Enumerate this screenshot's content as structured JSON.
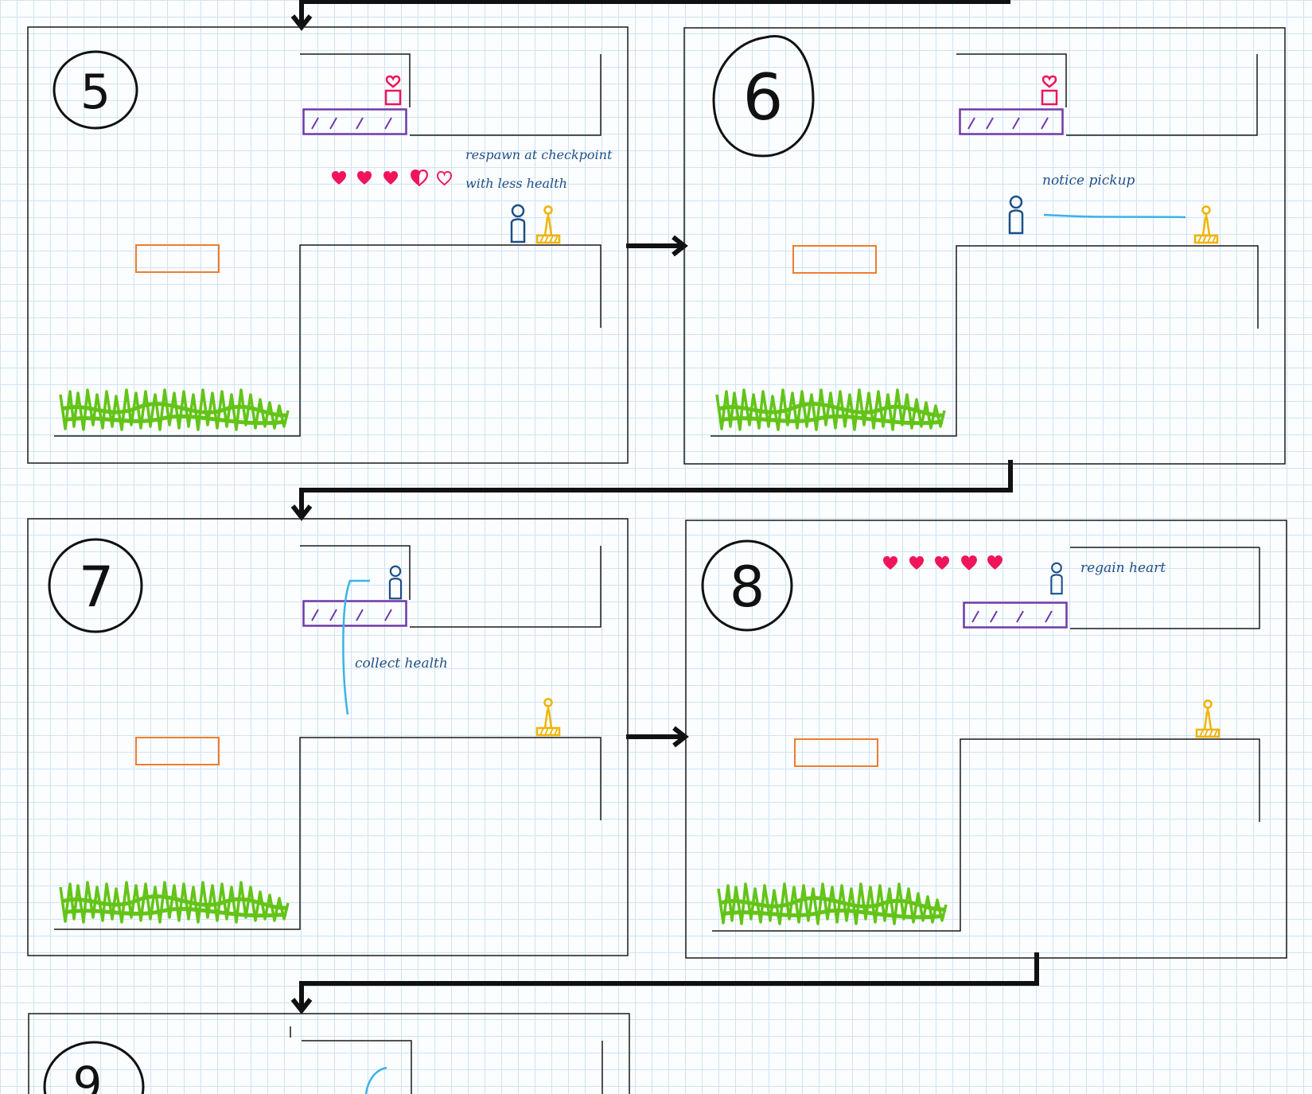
{
  "panels": [
    {
      "number": "5",
      "annotations": [
        "respawn at checkpoint",
        "with less health"
      ]
    },
    {
      "number": "6",
      "annotations": [
        "notice pickup"
      ]
    },
    {
      "number": "7",
      "annotations": [
        "collect health"
      ]
    },
    {
      "number": "8",
      "annotations": [
        "regain heart"
      ]
    },
    {
      "number": "9",
      "annotations": []
    }
  ],
  "colors": {
    "ink": "#1a1a1a",
    "player": "#1c4f86",
    "checkpoint": "#f0b400",
    "heart": "#f0145a",
    "platform_purple": "#6f3aa8",
    "block_orange": "#ee7d2c",
    "grass": "#63c417",
    "sightline": "#3bb3e8"
  },
  "icons": [
    "heart-icon",
    "health-pickup-icon",
    "player-icon",
    "checkpoint-flag-icon",
    "arrow-icon"
  ]
}
